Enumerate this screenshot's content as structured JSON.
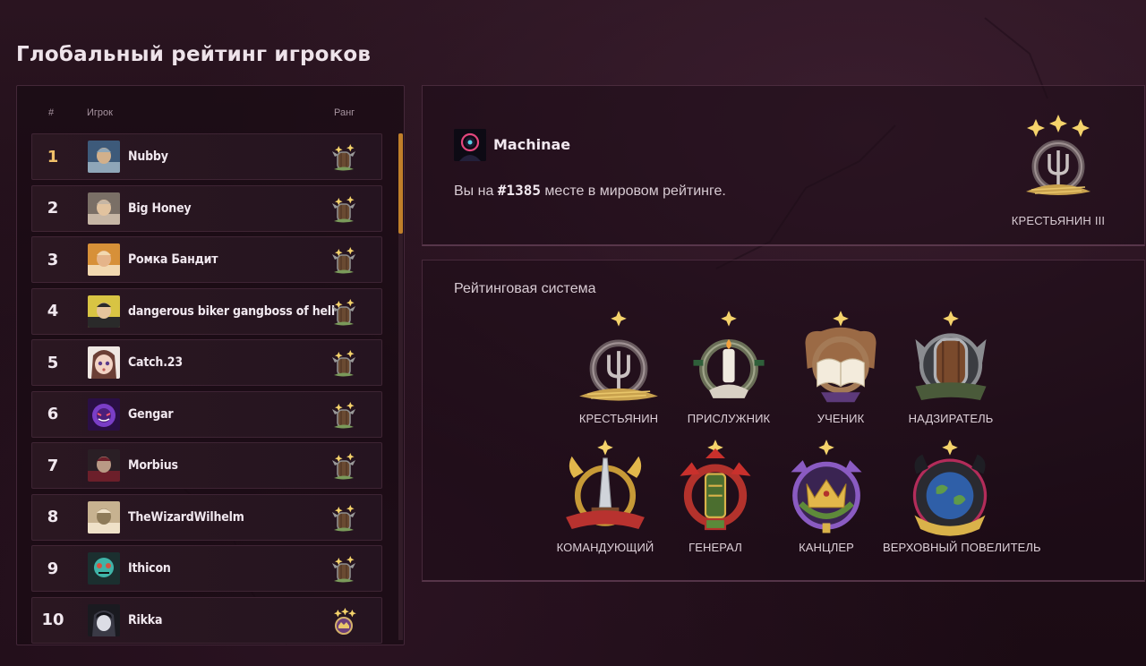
{
  "page": {
    "title": "Глобальный рейтинг игроков"
  },
  "leaderboard": {
    "headers": {
      "num": "#",
      "player": "Игрок",
      "rank": "Ранг"
    },
    "rows": [
      {
        "num": "1",
        "name": "Nubby",
        "avatar": "avatar-nubby"
      },
      {
        "num": "2",
        "name": "Big Honey",
        "avatar": "avatar-big-honey"
      },
      {
        "num": "3",
        "name": "Ромка Бандит",
        "avatar": "avatar-romka"
      },
      {
        "num": "4",
        "name": "dangerous biker gangboss of hell",
        "avatar": "avatar-biker"
      },
      {
        "num": "5",
        "name": "Catch.23",
        "avatar": "avatar-catch"
      },
      {
        "num": "6",
        "name": "Gengar",
        "avatar": "avatar-gengar"
      },
      {
        "num": "7",
        "name": "Morbius",
        "avatar": "avatar-morbius"
      },
      {
        "num": "8",
        "name": "TheWizardWilhelm",
        "avatar": "avatar-wizard"
      },
      {
        "num": "9",
        "name": "Ithicon",
        "avatar": "avatar-ithicon"
      },
      {
        "num": "10",
        "name": "Rikka",
        "avatar": "avatar-rikka"
      }
    ]
  },
  "player_card": {
    "name": "Machinae",
    "text_before": "Вы на ",
    "place": "#1385",
    "text_after": " месте в мировом рейтинге.",
    "rank_label": "КРЕСТЬЯНИН III"
  },
  "rating_system": {
    "title": "Рейтинговая система",
    "tiers": [
      {
        "label": "КРЕСТЬЯНИН",
        "icon": "pitchfork-emblem-icon"
      },
      {
        "label": "ПРИСЛУЖНИК",
        "icon": "candle-emblem-icon"
      },
      {
        "label": "УЧЕНИК",
        "icon": "book-emblem-icon"
      },
      {
        "label": "НАДЗИРАТЕЛЬ",
        "icon": "shield-emblem-icon"
      },
      {
        "label": "КОМАНДУЮЩИЙ",
        "icon": "sword-emblem-icon"
      },
      {
        "label": "ГЕНЕРАЛ",
        "icon": "epaulette-emblem-icon"
      },
      {
        "label": "КАНЦЛЕР",
        "icon": "crown-emblem-icon"
      },
      {
        "label": "ВЕРХОВНЫЙ ПОВЕЛИТЕЛЬ",
        "icon": "globe-emblem-icon"
      }
    ]
  },
  "colors": {
    "accent": "#c07f2a",
    "gold": "#f0c069",
    "star": "#f5d36b"
  }
}
